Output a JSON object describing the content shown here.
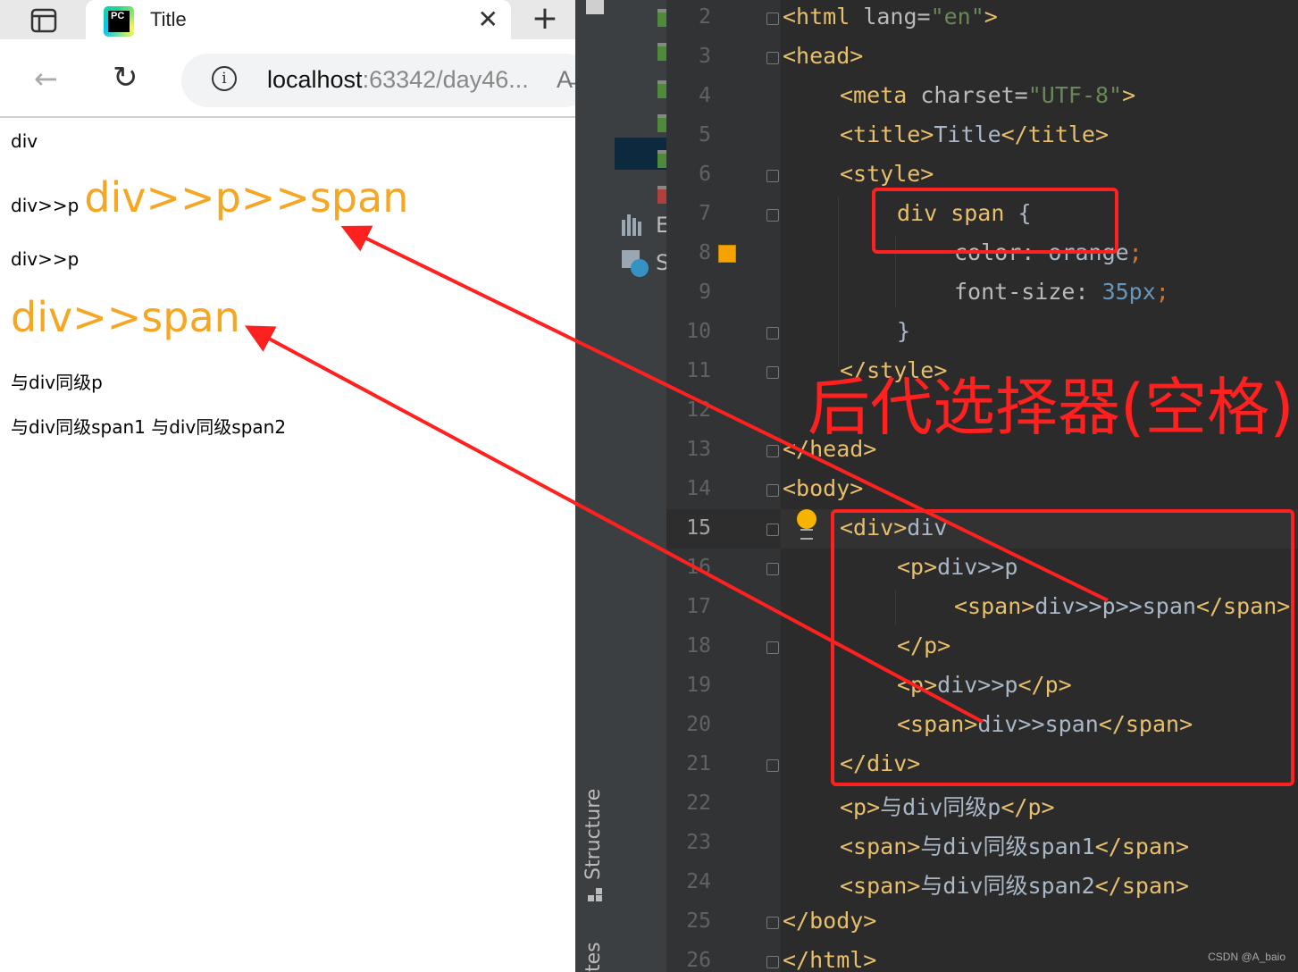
{
  "browser": {
    "tab_title": "Title",
    "tab_logo_text": "PC",
    "tab_close_glyph": "✕",
    "new_tab_glyph": "+",
    "address_host": "localhost",
    "address_rest": ":63342/day46...",
    "address_trailing": "A̵"
  },
  "page": {
    "line1": "div",
    "line2_small": "div>>p",
    "line2_big": "div>>p>>span",
    "line3": "div>>p",
    "line4_big": "div>>span",
    "line5": "与div同级p",
    "line6a": "与div同级span1",
    "line6b": "与div同级span2"
  },
  "ide": {
    "pane_letters": [
      "E",
      "S"
    ],
    "structure_label": "Structure",
    "bottom_label": "tes",
    "line_numbers": [
      "2",
      "3",
      "4",
      "5",
      "6",
      "7",
      "8",
      "9",
      "10",
      "11",
      "12",
      "13",
      "14",
      "15",
      "16",
      "17",
      "18",
      "19",
      "20",
      "21",
      "22",
      "23",
      "24",
      "25",
      "26"
    ],
    "code": {
      "l2": {
        "open": "<html ",
        "attr": "lang=",
        "val": "\"en\"",
        "close": ">"
      },
      "l3": "<head>",
      "l4": {
        "open": "<meta ",
        "attr": "charset=",
        "val": "\"UTF-8\"",
        "close": ">"
      },
      "l5": {
        "open": "<title>",
        "text": "Title",
        "close": "</title>"
      },
      "l6": "<style>",
      "l7": {
        "sel": "div span ",
        "brace": "{"
      },
      "l8": {
        "prop": "color: ",
        "val": "orange",
        "semi": ";"
      },
      "l9": {
        "prop": "font-size: ",
        "val": "35px",
        "semi": ";"
      },
      "l10": "}",
      "l11": "</style>",
      "l13": "</head>",
      "l14": "<body>",
      "l15": {
        "open": "<div>",
        "text": "div"
      },
      "l16": {
        "open": "<p>",
        "text": "div>>p"
      },
      "l17": {
        "open": "<span>",
        "text": "div>>p>>span",
        "close": "</span>"
      },
      "l18": "</p>",
      "l19": {
        "open": "<p>",
        "text": "div>>p",
        "close": "</p>"
      },
      "l20": {
        "open": "<span>",
        "text": "div>>span",
        "close": "</span>"
      },
      "l21": "</div>",
      "l22": {
        "open": "<p>",
        "text": "与div同级p",
        "close": "</p>"
      },
      "l23": {
        "open": "<span>",
        "text": "与div同级span1",
        "close": "</span>"
      },
      "l24": {
        "open": "<span>",
        "text": "与div同级span2",
        "close": "</span>"
      },
      "l25": "</body>",
      "l26": "</html>"
    }
  },
  "annotation": {
    "label": "后代选择器(空格)",
    "color": "#ff2020"
  },
  "watermark": "CSDN @A_baio",
  "colors": {
    "orange_text": "#f5a623",
    "ide_bg": "#2b2b2b",
    "tag": "#e8bf6a",
    "string": "#6a8759",
    "number": "#6897bb",
    "punctuation": "#cc7832"
  }
}
